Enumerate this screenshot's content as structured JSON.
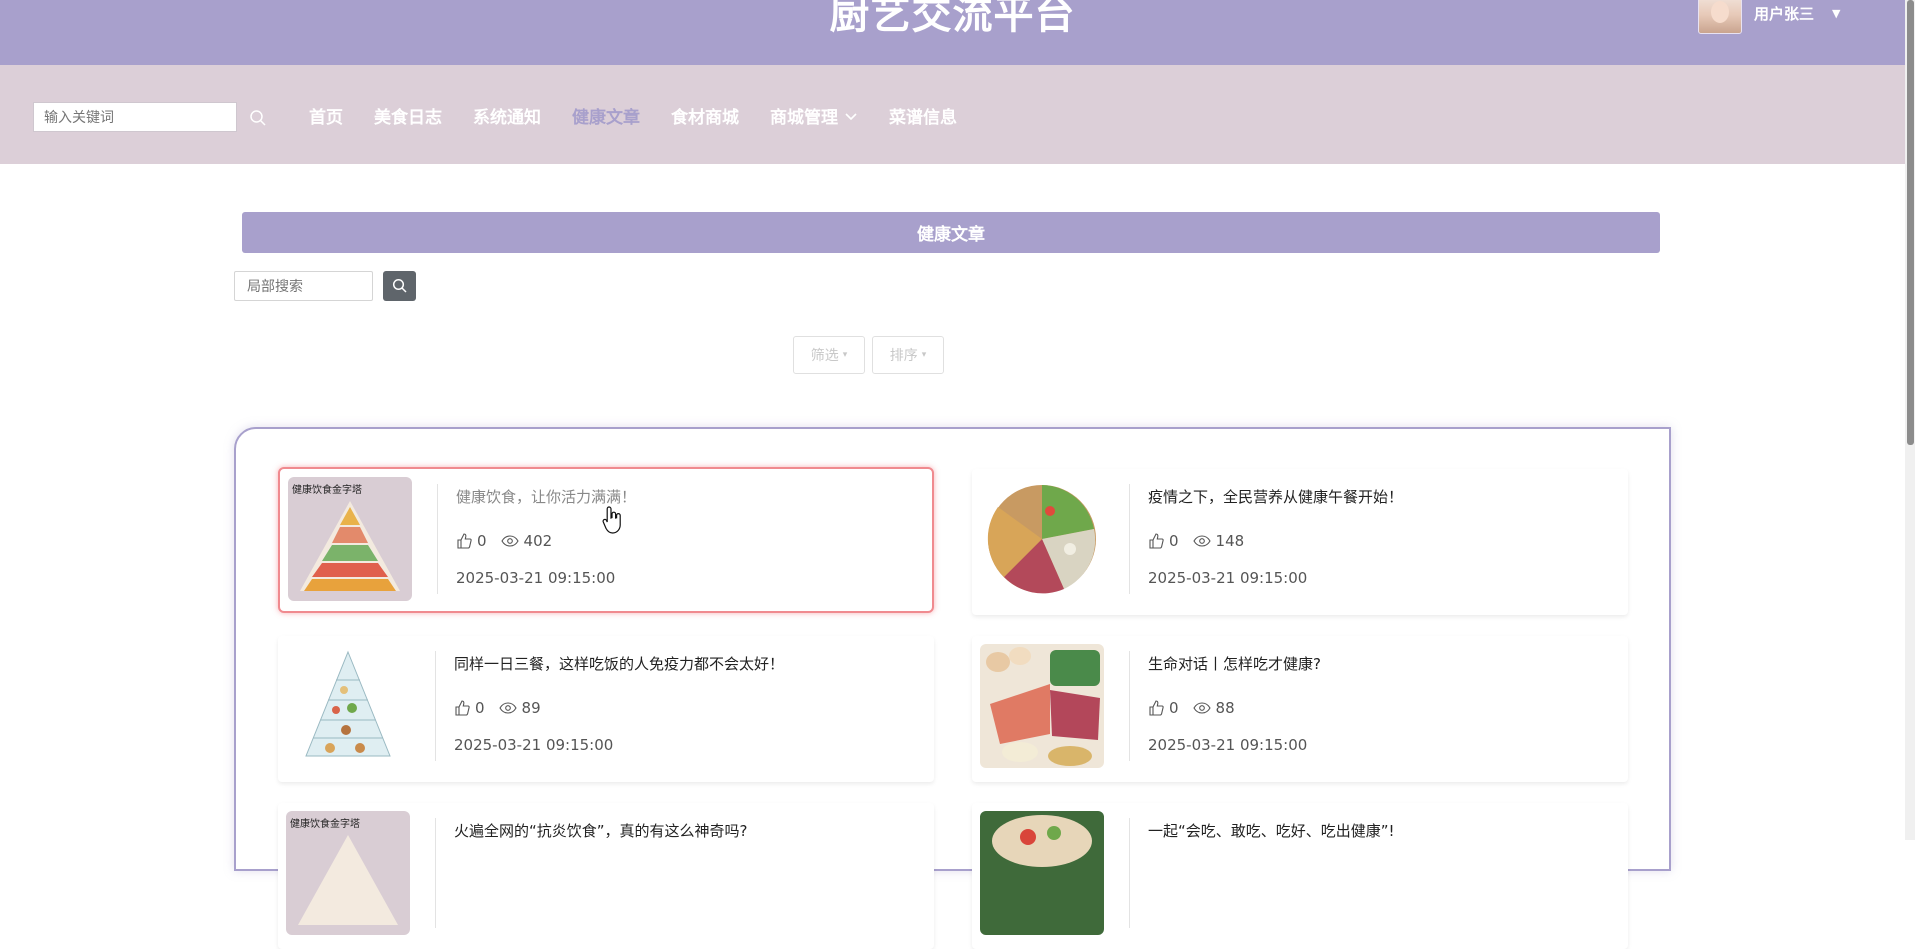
{
  "header": {
    "site_title": "厨艺交流平台",
    "user_name": "用户张三",
    "user_caret": "▼"
  },
  "nav": {
    "search_placeholder": "输入关键词",
    "items": [
      {
        "label": "首页"
      },
      {
        "label": "美食日志"
      },
      {
        "label": "系统通知"
      },
      {
        "label": "健康文章",
        "active": true
      },
      {
        "label": "食材商城"
      },
      {
        "label": "商城管理",
        "has_dropdown": true
      },
      {
        "label": "菜谱信息"
      }
    ]
  },
  "section": {
    "title": "健康文章",
    "local_search_placeholder": "局部搜索",
    "filter_label": "筛选",
    "sort_label": "排序",
    "caret": "▾"
  },
  "articles": [
    {
      "title": "健康饮食，让你活力满满！",
      "likes": "0",
      "views": "402",
      "date": "2025-03-21 09:15:00",
      "thumb": "food-pyramid"
    },
    {
      "title": "疫情之下，全民营养从健康午餐开始！",
      "likes": "0",
      "views": "148",
      "date": "2025-03-21 09:15:00",
      "thumb": "food-circle"
    },
    {
      "title": "同样一日三餐，这样吃饭的人免疫力都不会太好！",
      "likes": "0",
      "views": "89",
      "date": "2025-03-21 09:15:00",
      "thumb": "pyramid-diagram"
    },
    {
      "title": "生命对话丨怎样吃才健康?",
      "likes": "0",
      "views": "88",
      "date": "2025-03-21 09:15:00",
      "thumb": "ingredients-photo"
    },
    {
      "title": "火遍全网的“抗炎饮食”，真的有这么神奇吗?",
      "likes": "",
      "views": "",
      "date": "",
      "thumb": "food-pyramid"
    },
    {
      "title": "一起“会吃、敢吃、吃好、吃出健康”!",
      "likes": "",
      "views": "",
      "date": "",
      "thumb": "salad-photo"
    }
  ],
  "colors": {
    "primary": "#a8a0cc",
    "navbar_bg": "#dccfd8",
    "hover_border": "#f08a8f"
  }
}
